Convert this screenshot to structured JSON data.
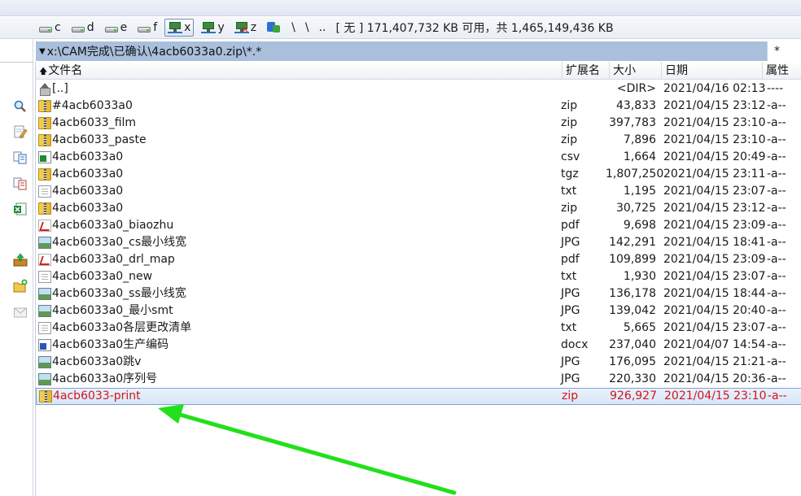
{
  "drive_bar": {
    "drives": [
      {
        "letter": "c",
        "icon": "hard-disk-icon",
        "active": false
      },
      {
        "letter": "d",
        "icon": "hard-disk-icon",
        "active": false
      },
      {
        "letter": "e",
        "icon": "hard-disk-icon",
        "active": false
      },
      {
        "letter": "f",
        "icon": "hard-disk-icon",
        "active": false
      },
      {
        "letter": "x",
        "icon": "network-drive-icon",
        "active": true
      },
      {
        "letter": "y",
        "icon": "network-drive-icon",
        "active": false
      },
      {
        "letter": "z",
        "icon": "network-drive-disconnected-icon",
        "active": false
      }
    ],
    "net_symbol": "\\",
    "root_symbol": "\\",
    "parent_symbol": "..",
    "free_space": "[ 无 ]  171,407,732 KB 可用，共 1,465,149,436 KB"
  },
  "path_bar": {
    "path": "x:\\CAM完成\\已确认\\4acb6033a0.zip\\*.*",
    "filter": "*"
  },
  "columns": {
    "name": "文件名",
    "ext": "扩展名",
    "size": "大小",
    "date": "日期",
    "attr": "属性"
  },
  "files": [
    {
      "icon": "up",
      "name": "[..]",
      "ext": "",
      "size": "<DIR>",
      "date": "2021/04/16 02:13",
      "attr": "----"
    },
    {
      "icon": "zip",
      "name": "#4acb6033a0",
      "ext": "zip",
      "size": "43,833",
      "date": "2021/04/15 23:12",
      "attr": "-a--"
    },
    {
      "icon": "zip",
      "name": "4acb6033_film",
      "ext": "zip",
      "size": "397,783",
      "date": "2021/04/15 23:10",
      "attr": "-a--"
    },
    {
      "icon": "zip",
      "name": "4acb6033_paste",
      "ext": "zip",
      "size": "7,896",
      "date": "2021/04/15 23:10",
      "attr": "-a--"
    },
    {
      "icon": "csv",
      "name": "4acb6033a0",
      "ext": "csv",
      "size": "1,664",
      "date": "2021/04/15 20:49",
      "attr": "-a--"
    },
    {
      "icon": "zip",
      "name": "4acb6033a0",
      "ext": "tgz",
      "size": "1,807,250",
      "date": "2021/04/15 23:11",
      "attr": "-a--"
    },
    {
      "icon": "txt",
      "name": "4acb6033a0",
      "ext": "txt",
      "size": "1,195",
      "date": "2021/04/15 23:07",
      "attr": "-a--"
    },
    {
      "icon": "zip",
      "name": "4acb6033a0",
      "ext": "zip",
      "size": "30,725",
      "date": "2021/04/15 23:12",
      "attr": "-a--"
    },
    {
      "icon": "pdf",
      "name": "4acb6033a0_biaozhu",
      "ext": "pdf",
      "size": "9,698",
      "date": "2021/04/15 23:09",
      "attr": "-a--"
    },
    {
      "icon": "jpg",
      "name": "4acb6033a0_cs最小线宽",
      "ext": "JPG",
      "size": "142,291",
      "date": "2021/04/15 18:41",
      "attr": "-a--"
    },
    {
      "icon": "pdf",
      "name": "4acb6033a0_drl_map",
      "ext": "pdf",
      "size": "109,899",
      "date": "2021/04/15 23:09",
      "attr": "-a--"
    },
    {
      "icon": "txt",
      "name": "4acb6033a0_new",
      "ext": "txt",
      "size": "1,930",
      "date": "2021/04/15 23:07",
      "attr": "-a--"
    },
    {
      "icon": "jpg",
      "name": "4acb6033a0_ss最小线宽",
      "ext": "JPG",
      "size": "136,178",
      "date": "2021/04/15 18:44",
      "attr": "-a--"
    },
    {
      "icon": "jpg",
      "name": "4acb6033a0_最小smt",
      "ext": "JPG",
      "size": "139,042",
      "date": "2021/04/15 20:40",
      "attr": "-a--"
    },
    {
      "icon": "txt",
      "name": "4acb6033a0各层更改清单",
      "ext": "txt",
      "size": "5,665",
      "date": "2021/04/15 23:07",
      "attr": "-a--"
    },
    {
      "icon": "docx",
      "name": "4acb6033a0生产编码",
      "ext": "docx",
      "size": "237,040",
      "date": "2021/04/07 14:54",
      "attr": "-a--"
    },
    {
      "icon": "jpg",
      "name": "4acb6033a0跳v",
      "ext": "JPG",
      "size": "176,095",
      "date": "2021/04/15 21:21",
      "attr": "-a--"
    },
    {
      "icon": "jpg",
      "name": "4acb6033a0序列号",
      "ext": "JPG",
      "size": "220,330",
      "date": "2021/04/15 20:36",
      "attr": "-a--"
    },
    {
      "icon": "zip",
      "name": "4acb6033-print",
      "ext": "zip",
      "size": "926,927",
      "date": "2021/04/15 23:10",
      "attr": "-a--",
      "selected": true
    }
  ],
  "annotation": {
    "color": "#22e01a"
  },
  "colors": {
    "selected_text": "#d3151b",
    "path_bar": "#a9bfdc"
  },
  "left_toolbar_icons": [
    "search-icon",
    "edit-icon",
    "copy-icon",
    "move-icon",
    "excel-icon",
    "pack-icon",
    "new-folder-icon",
    "mail-icon"
  ]
}
